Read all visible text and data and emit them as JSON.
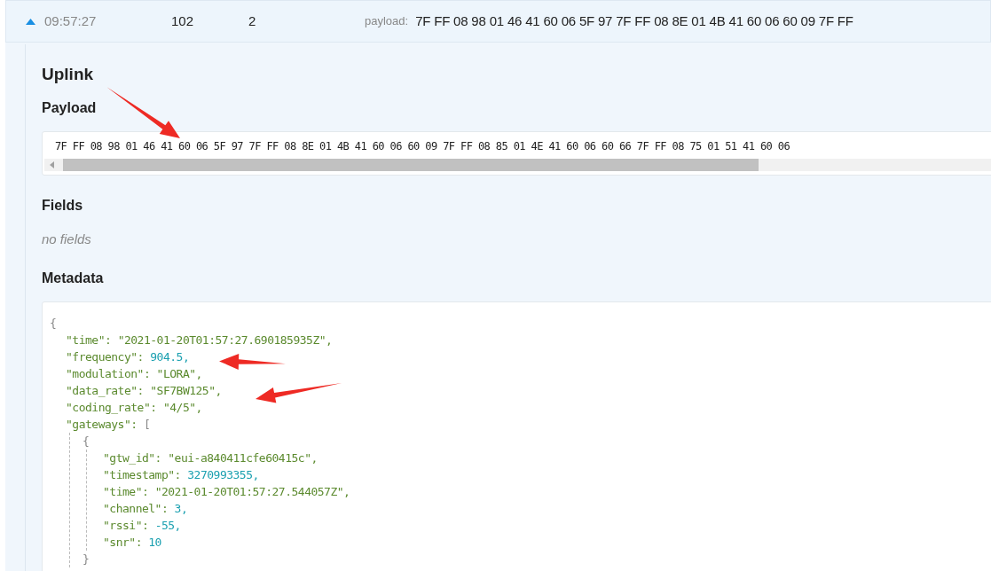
{
  "row": {
    "expanded": true,
    "time": "09:57:27",
    "column_2": "102",
    "column_3": "2",
    "payload_label": "payload:",
    "payload": "7F FF 08 98 01 46 41 60 06 5F 97 7F FF 08 8E 01 4B 41 60 06 60 09 7F FF"
  },
  "detail": {
    "title": "Uplink",
    "payload": {
      "heading": "Payload",
      "hex": "7F FF 08 98 01 46 41 60 06 5F 97 7F FF 08 8E 01 4B 41 60 06 60 09 7F FF 08 85 01 4E 41 60 06 60 66 7F FF 08 75 01 51 41 60 06"
    },
    "fields": {
      "heading": "Fields",
      "empty_text": "no fields"
    },
    "metadata": {
      "heading": "Metadata",
      "open": "{",
      "entries": [
        {
          "key": "\"time\":",
          "value": "\"2021-01-20T01:57:27.690185935Z\",",
          "kind": "string"
        },
        {
          "key": "\"frequency\":",
          "value": "904.5,",
          "kind": "number"
        },
        {
          "key": "\"modulation\":",
          "value": "\"LORA\",",
          "kind": "string"
        },
        {
          "key": "\"data_rate\":",
          "value": "\"SF7BW125\",",
          "kind": "string"
        },
        {
          "key": "\"coding_rate\":",
          "value": "\"4/5\",",
          "kind": "string"
        },
        {
          "key": "\"gateways\":",
          "value": "[",
          "kind": "array",
          "children": [
            {
              "open": "{",
              "close": "}",
              "entries": [
                {
                  "key": "\"gtw_id\":",
                  "value": "\"eui-a840411cfe60415c\",",
                  "kind": "string"
                },
                {
                  "key": "\"timestamp\":",
                  "value": "3270993355,",
                  "kind": "number"
                },
                {
                  "key": "\"time\":",
                  "value": "\"2021-01-20T01:57:27.544057Z\",",
                  "kind": "string"
                },
                {
                  "key": "\"channel\":",
                  "value": "3,",
                  "kind": "number"
                },
                {
                  "key": "\"rssi\":",
                  "value": "-55,",
                  "kind": "number"
                },
                {
                  "key": "\"snr\":",
                  "value": "10",
                  "kind": "number"
                }
              ]
            }
          ]
        }
      ]
    }
  }
}
